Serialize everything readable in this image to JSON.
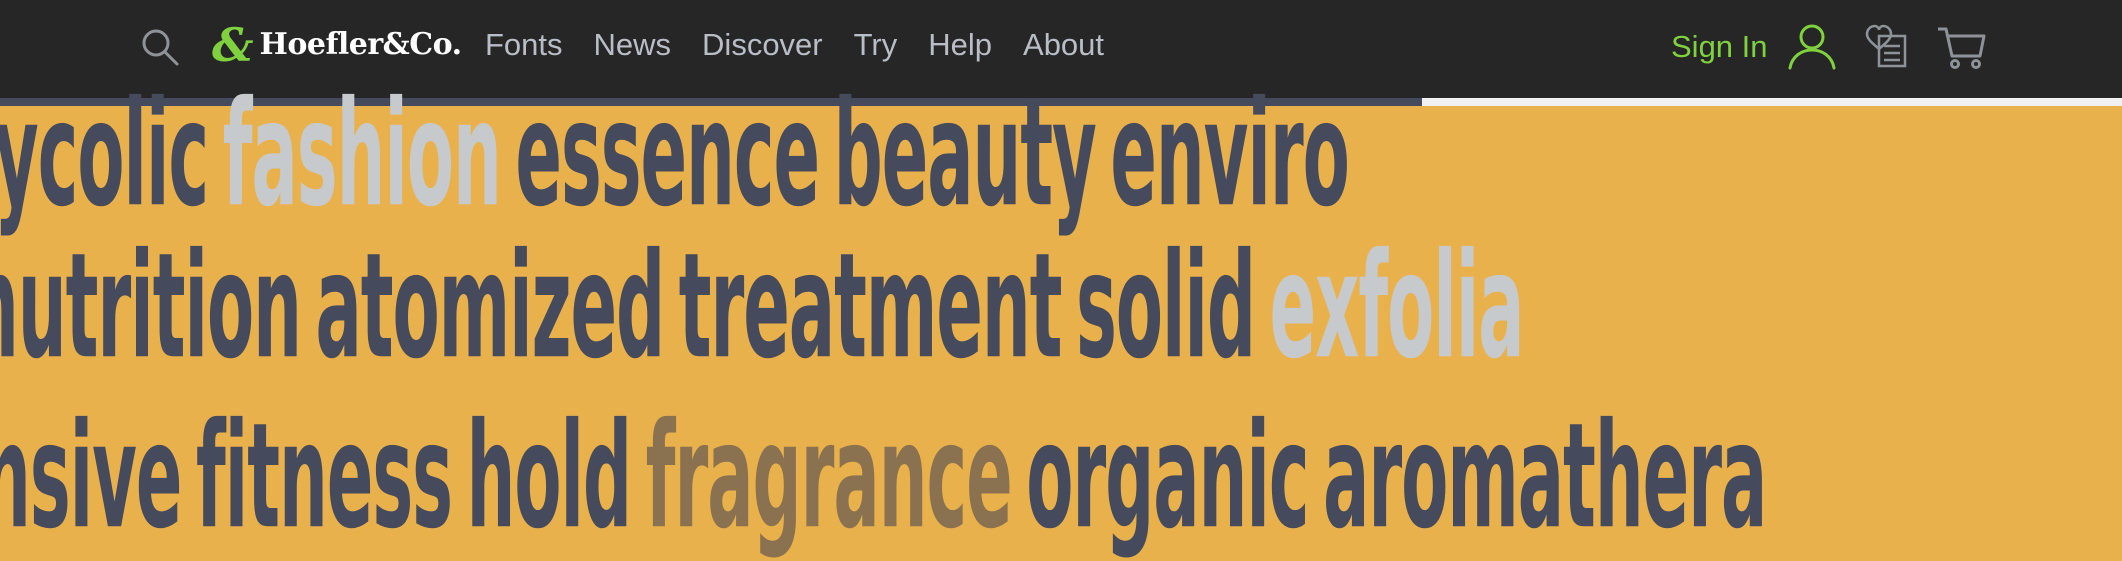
{
  "header": {
    "logo_amp": "&",
    "logo_text": "Hoefler&Co.",
    "nav": [
      "Fonts",
      "News",
      "Discover",
      "Try",
      "Help",
      "About"
    ],
    "sign_in": "Sign In",
    "icons": [
      "search-icon",
      "user-icon",
      "favorites-icon",
      "cart-icon"
    ],
    "scroll_progress_percent": 33
  },
  "colors": {
    "background": "#e9b14c",
    "text": "#454a5c",
    "highlight": "#c7cacd",
    "muted": "#8a7150",
    "accent": "#7fd23e",
    "nav_text": "#b9bec6",
    "topbar": "#262626"
  },
  "specimen": {
    "line1": [
      "ycolic",
      "fashion",
      "essence",
      "beauty",
      "enviro"
    ],
    "line2": [
      "nutrition",
      "atomized",
      "treatment",
      "solid",
      "exfolia"
    ],
    "line3": [
      "nsive",
      "fitness",
      "hold",
      "fragrance",
      "organic",
      "aromathera"
    ]
  }
}
